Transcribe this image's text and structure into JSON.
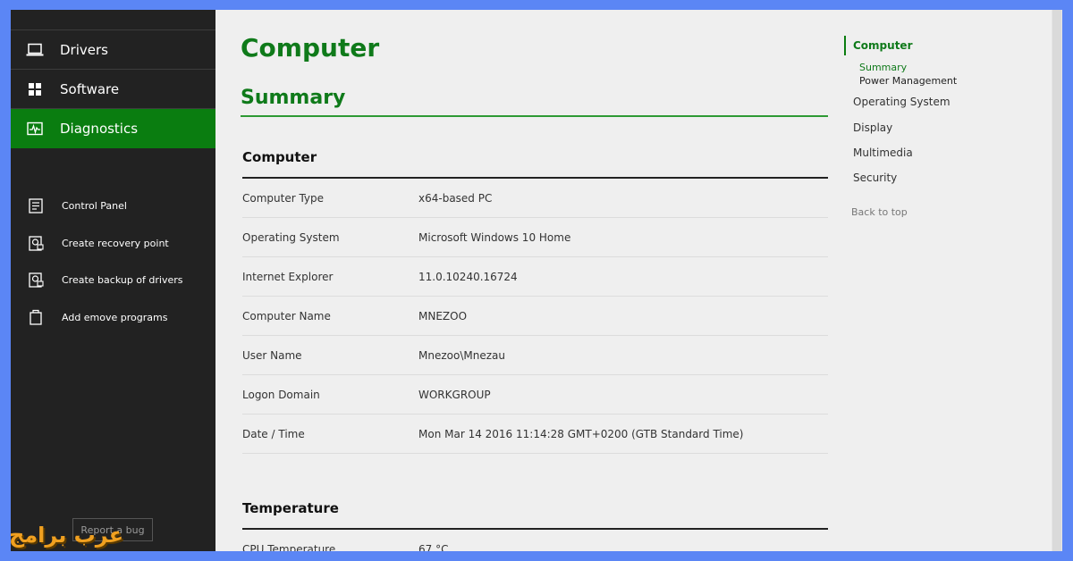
{
  "sidebar": {
    "nav": [
      {
        "label": "Drivers",
        "icon": "laptop-icon"
      },
      {
        "label": "Software",
        "icon": "windows-grid-icon"
      },
      {
        "label": "Diagnostics",
        "icon": "diagnostics-monitor-icon",
        "active": true
      }
    ],
    "tools": [
      {
        "label": "Control Panel",
        "icon": "control-panel-icon"
      },
      {
        "label": "Create recovery point",
        "icon": "drive-restore-icon"
      },
      {
        "label": "Create backup of drivers",
        "icon": "drive-backup-icon"
      },
      {
        "label": "Add emove programs",
        "icon": "programs-box-icon"
      }
    ],
    "report_bug": "Report a bug",
    "brand_text": "عرب برامج"
  },
  "main": {
    "title": "Computer",
    "section": "Summary",
    "computer_group": {
      "title": "Computer",
      "rows": [
        {
          "key": "Computer Type",
          "value": "x64-based PC"
        },
        {
          "key": "Operating System",
          "value": "Microsoft Windows 10 Home"
        },
        {
          "key": "Internet Explorer",
          "value": "11.0.10240.16724"
        },
        {
          "key": "Computer Name",
          "value": "MNEZOO"
        },
        {
          "key": "User Name",
          "value": "Mnezoo\\Mnezau"
        },
        {
          "key": "Logon Domain",
          "value": "WORKGROUP"
        },
        {
          "key": "Date / Time",
          "value": "Mon Mar 14 2016 11:14:28 GMT+0200 (GTB Standard Time)"
        }
      ]
    },
    "temperature_group": {
      "title": "Temperature",
      "rows": [
        {
          "key": "CPU Temperature",
          "value": "67 °C"
        }
      ]
    }
  },
  "toc": {
    "heading": "Computer",
    "subitems": [
      "Summary",
      "Power Management"
    ],
    "items": [
      "Operating System",
      "Display",
      "Multimedia",
      "Security"
    ],
    "back": "Back to top"
  },
  "colors": {
    "accent": "#0a7d10",
    "title_green": "#0f7a1a",
    "sidebar_bg": "#222222",
    "content_bg": "#efefef",
    "frame_blue": "#5b86f5",
    "brand_orange": "#f0a020"
  }
}
